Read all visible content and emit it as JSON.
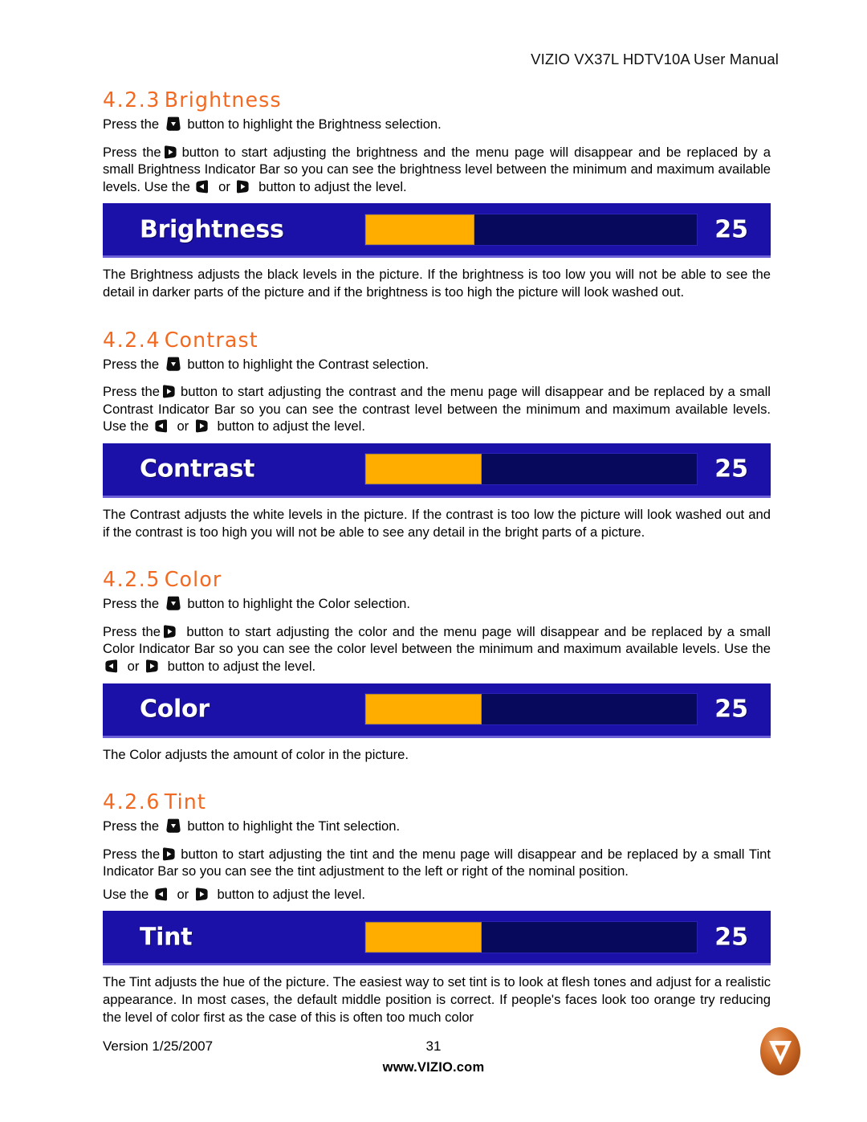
{
  "header": {
    "title": "VIZIO VX37L HDTV10A User Manual"
  },
  "sections": [
    {
      "number": "4.2.3",
      "title": "Brightness",
      "paragraphs": [
        "Press the  button to highlight the Brightness selection.",
        "Press the button to start adjusting the brightness and the menu page will disappear and be replaced by a small Brightness Indicator Bar so you can see the brightness level between the minimum and maximum available levels.  Use the  or  button to adjust the level."
      ],
      "p1_pre": "Press the",
      "p1_post": "button to highlight the Brightness selection.",
      "p2_a": "Press the",
      "p2_b": "button to start adjusting the brightness and the menu page will disappear and be replaced by a small Brightness Indicator Bar so you can see the brightness level between the minimum and maximum available levels.  Use the",
      "p2_c": "or",
      "p2_d": "button to adjust the level.",
      "osd": {
        "label": "Brightness",
        "value": "25",
        "fill_percent": 33
      },
      "after": "The Brightness adjusts the black levels in the picture.  If the brightness is too low you will not be able to see the detail in darker parts of the picture and if the brightness is too high the picture will look washed out."
    },
    {
      "number": "4.2.4",
      "title": "Contrast",
      "p1_pre": "Press the",
      "p1_post": "button to highlight the Contrast selection.",
      "p2_a": "Press the",
      "p2_b": "button to start adjusting the contrast and the menu page will disappear and be replaced by a small Contrast Indicator Bar so you can see the contrast level between the minimum and maximum available levels.  Use the",
      "p2_c": "or",
      "p2_d": "button to adjust the level.",
      "osd": {
        "label": "Contrast",
        "value": "25",
        "fill_percent": 35
      },
      "after": "The Contrast adjusts the white levels in the picture.  If the contrast is too low the picture will look washed out and if the contrast is too high you will not be able to see any detail in the bright parts of a picture."
    },
    {
      "number": "4.2.5",
      "title": "Color",
      "p1_pre": "Press the",
      "p1_post": "button to highlight the Color selection.",
      "p2_a": "Press the",
      "p2_b": "button to start adjusting the color and the menu page will disappear and be replaced by a small Color Indicator Bar so you can see the color level between the minimum and maximum available levels.  Use the",
      "p2_c": "or",
      "p2_d": "button to adjust the level.",
      "osd": {
        "label": "Color",
        "value": "25",
        "fill_percent": 35
      },
      "after": "The Color adjusts the amount of color in the picture."
    },
    {
      "number": "4.2.6",
      "title": "Tint",
      "p1_pre": "Press the",
      "p1_post": "button to highlight the Tint selection.",
      "p2_a": "Press the",
      "p2_b": "button to start adjusting the tint and the menu page will disappear and be replaced by a small Tint Indicator Bar so you can see the tint adjustment to the left or right of the nominal position.",
      "p3_a": "Use the",
      "p3_b": "or",
      "p3_c": "button to adjust the level.",
      "osd": {
        "label": "Tint",
        "value": "25",
        "fill_percent": 35
      },
      "after": "The Tint adjusts the hue of the picture.  The easiest way to set tint is to look at flesh tones and adjust for a realistic appearance.  In most cases, the default middle position is correct.  If people's faces look too orange try reducing the level of color first as the case of this is often too much color"
    }
  ],
  "footer": {
    "version": "Version 1/25/2007",
    "page_number": "31",
    "website": "www.VIZIO.com",
    "logo_letter": "V"
  },
  "colors": {
    "heading_orange": "#F26A21",
    "osd_background": "#1B11A8",
    "osd_track": "#070A5C",
    "osd_fill": "#FFAE00",
    "logo_orange": "#D4702A",
    "text_black": "#000000"
  },
  "icons": {
    "down_button": "remote-down-button-icon",
    "right_button": "remote-right-button-icon",
    "left_button": "remote-left-button-icon"
  }
}
